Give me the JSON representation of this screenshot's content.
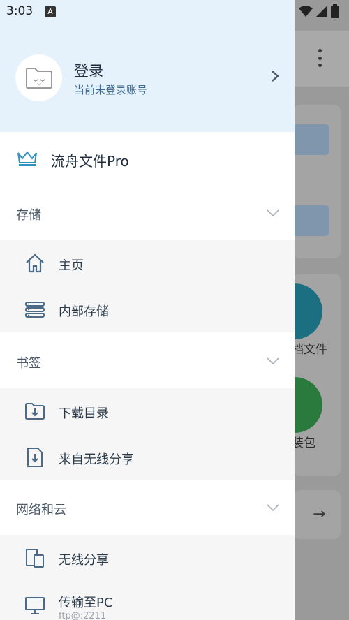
{
  "status_bar": {
    "time": "3:03",
    "notification_badge": "A"
  },
  "drawer": {
    "account": {
      "title": "登录",
      "subtitle": "当前未登录账号"
    },
    "pro": {
      "label": "流舟文件Pro"
    },
    "sections": [
      {
        "label": "存储",
        "items": [
          {
            "label": "主页"
          },
          {
            "label": "内部存储"
          }
        ]
      },
      {
        "label": "书签",
        "items": [
          {
            "label": "下载目录"
          },
          {
            "label": "来自无线分享"
          }
        ]
      },
      {
        "label": "网络和云",
        "items": [
          {
            "label": "无线分享"
          },
          {
            "label": "传输至PC",
            "sub": "ftp@:2211"
          }
        ]
      }
    ]
  },
  "background": {
    "label_1": "档文件",
    "label_2": "装包"
  },
  "colors": {
    "accent": "#3a7ea8",
    "header_bg": "#e5f1fb",
    "icon": "#4a6a88"
  }
}
